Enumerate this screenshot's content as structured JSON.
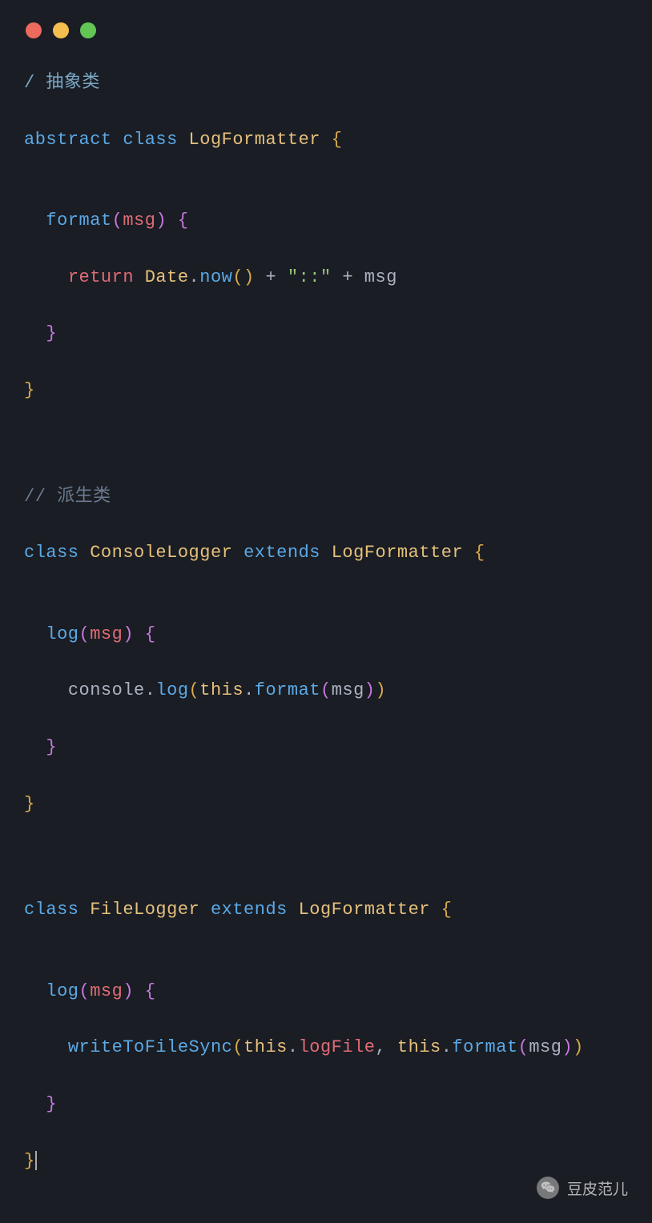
{
  "code": {
    "comment1": "/ 抽象类",
    "line1": {
      "abstract": "abstract",
      "class": "class",
      "name": "LogFormatter",
      "brace": "{"
    },
    "line2": {
      "indent": "  ",
      "method": "format",
      "paren_open": "(",
      "param": "msg",
      "paren_close": ")",
      "brace": " {"
    },
    "line3": {
      "indent": "    ",
      "return": "return",
      "date": "Date",
      "dot": ".",
      "now": "now",
      "parens": "()",
      "plus1": " + ",
      "string": "\"::\"",
      "plus2": " + ",
      "msg": "msg"
    },
    "line4": {
      "indent": "  ",
      "brace": "}"
    },
    "line5": {
      "brace": "}"
    },
    "comment2": "// 派生类",
    "line6": {
      "class": "class",
      "name": "ConsoleLogger",
      "extends": "extends",
      "parent": "LogFormatter",
      "brace": " {"
    },
    "line7": {
      "indent": "  ",
      "method": "log",
      "paren_open": "(",
      "param": "msg",
      "paren_close": ")",
      "brace": " {"
    },
    "line8": {
      "indent": "    ",
      "console": "console",
      "dot1": ".",
      "log": "log",
      "paren_open": "(",
      "this": "this",
      "dot2": ".",
      "format": "format",
      "paren2_open": "(",
      "msg": "msg",
      "paren2_close": ")",
      "paren_close": ")"
    },
    "line9": {
      "indent": "  ",
      "brace": "}"
    },
    "line10": {
      "brace": "}"
    },
    "line11": {
      "class": "class",
      "name": "FileLogger",
      "extends": "extends",
      "parent": "LogFormatter",
      "brace": " {"
    },
    "line12": {
      "indent": "  ",
      "method": "log",
      "paren_open": "(",
      "param": "msg",
      "paren_close": ")",
      "brace": " {"
    },
    "line13": {
      "indent": "    ",
      "fn": "writeToFileSync",
      "paren_open": "(",
      "this1": "this",
      "dot1": ".",
      "logfile": "logFile",
      "comma": ", ",
      "this2": "this",
      "dot2": ".",
      "format": "format",
      "paren2_open": "(",
      "msg": "msg",
      "paren2_close": ")",
      "paren_close": ")"
    },
    "line14": {
      "indent": "  ",
      "brace": "}"
    },
    "line15": {
      "brace": "}"
    }
  },
  "watermark": {
    "text": "豆皮范儿",
    "icon": "wechat-icon"
  }
}
